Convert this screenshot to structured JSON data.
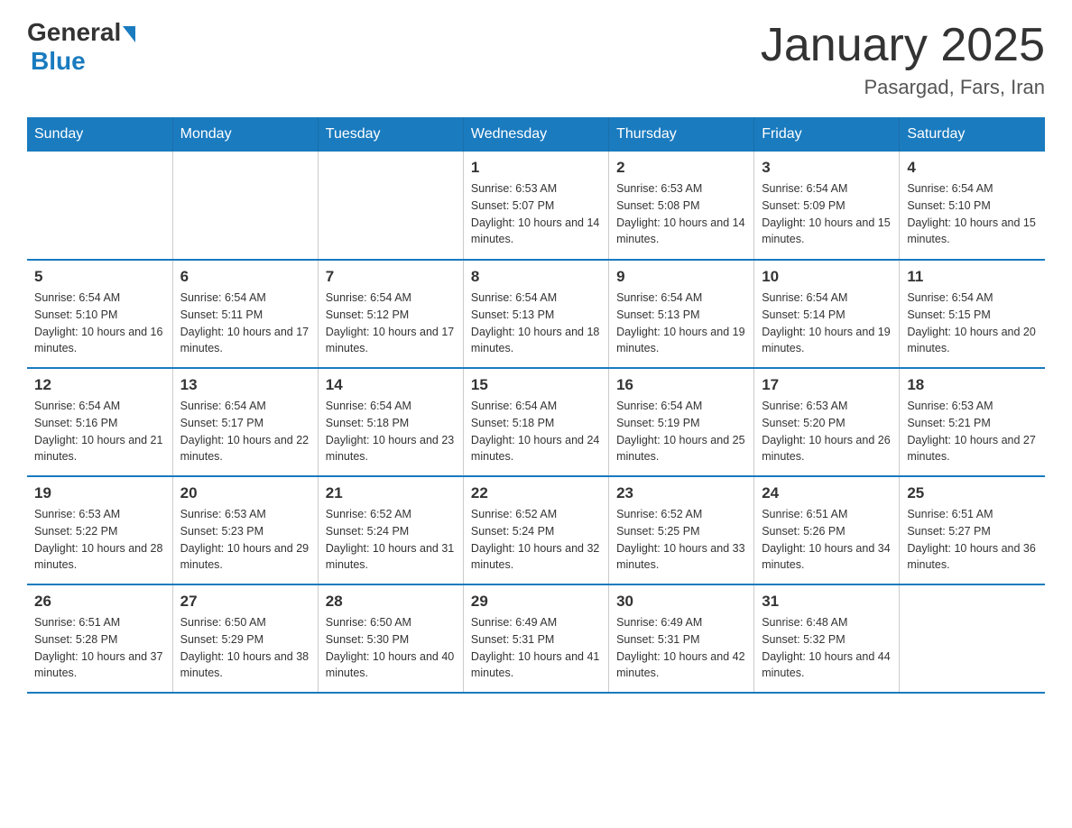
{
  "logo": {
    "general": "General",
    "blue": "Blue"
  },
  "title": "January 2025",
  "subtitle": "Pasargad, Fars, Iran",
  "headers": [
    "Sunday",
    "Monday",
    "Tuesday",
    "Wednesday",
    "Thursday",
    "Friday",
    "Saturday"
  ],
  "weeks": [
    [
      {
        "day": "",
        "sunrise": "",
        "sunset": "",
        "daylight": ""
      },
      {
        "day": "",
        "sunrise": "",
        "sunset": "",
        "daylight": ""
      },
      {
        "day": "",
        "sunrise": "",
        "sunset": "",
        "daylight": ""
      },
      {
        "day": "1",
        "sunrise": "Sunrise: 6:53 AM",
        "sunset": "Sunset: 5:07 PM",
        "daylight": "Daylight: 10 hours and 14 minutes."
      },
      {
        "day": "2",
        "sunrise": "Sunrise: 6:53 AM",
        "sunset": "Sunset: 5:08 PM",
        "daylight": "Daylight: 10 hours and 14 minutes."
      },
      {
        "day": "3",
        "sunrise": "Sunrise: 6:54 AM",
        "sunset": "Sunset: 5:09 PM",
        "daylight": "Daylight: 10 hours and 15 minutes."
      },
      {
        "day": "4",
        "sunrise": "Sunrise: 6:54 AM",
        "sunset": "Sunset: 5:10 PM",
        "daylight": "Daylight: 10 hours and 15 minutes."
      }
    ],
    [
      {
        "day": "5",
        "sunrise": "Sunrise: 6:54 AM",
        "sunset": "Sunset: 5:10 PM",
        "daylight": "Daylight: 10 hours and 16 minutes."
      },
      {
        "day": "6",
        "sunrise": "Sunrise: 6:54 AM",
        "sunset": "Sunset: 5:11 PM",
        "daylight": "Daylight: 10 hours and 17 minutes."
      },
      {
        "day": "7",
        "sunrise": "Sunrise: 6:54 AM",
        "sunset": "Sunset: 5:12 PM",
        "daylight": "Daylight: 10 hours and 17 minutes."
      },
      {
        "day": "8",
        "sunrise": "Sunrise: 6:54 AM",
        "sunset": "Sunset: 5:13 PM",
        "daylight": "Daylight: 10 hours and 18 minutes."
      },
      {
        "day": "9",
        "sunrise": "Sunrise: 6:54 AM",
        "sunset": "Sunset: 5:13 PM",
        "daylight": "Daylight: 10 hours and 19 minutes."
      },
      {
        "day": "10",
        "sunrise": "Sunrise: 6:54 AM",
        "sunset": "Sunset: 5:14 PM",
        "daylight": "Daylight: 10 hours and 19 minutes."
      },
      {
        "day": "11",
        "sunrise": "Sunrise: 6:54 AM",
        "sunset": "Sunset: 5:15 PM",
        "daylight": "Daylight: 10 hours and 20 minutes."
      }
    ],
    [
      {
        "day": "12",
        "sunrise": "Sunrise: 6:54 AM",
        "sunset": "Sunset: 5:16 PM",
        "daylight": "Daylight: 10 hours and 21 minutes."
      },
      {
        "day": "13",
        "sunrise": "Sunrise: 6:54 AM",
        "sunset": "Sunset: 5:17 PM",
        "daylight": "Daylight: 10 hours and 22 minutes."
      },
      {
        "day": "14",
        "sunrise": "Sunrise: 6:54 AM",
        "sunset": "Sunset: 5:18 PM",
        "daylight": "Daylight: 10 hours and 23 minutes."
      },
      {
        "day": "15",
        "sunrise": "Sunrise: 6:54 AM",
        "sunset": "Sunset: 5:18 PM",
        "daylight": "Daylight: 10 hours and 24 minutes."
      },
      {
        "day": "16",
        "sunrise": "Sunrise: 6:54 AM",
        "sunset": "Sunset: 5:19 PM",
        "daylight": "Daylight: 10 hours and 25 minutes."
      },
      {
        "day": "17",
        "sunrise": "Sunrise: 6:53 AM",
        "sunset": "Sunset: 5:20 PM",
        "daylight": "Daylight: 10 hours and 26 minutes."
      },
      {
        "day": "18",
        "sunrise": "Sunrise: 6:53 AM",
        "sunset": "Sunset: 5:21 PM",
        "daylight": "Daylight: 10 hours and 27 minutes."
      }
    ],
    [
      {
        "day": "19",
        "sunrise": "Sunrise: 6:53 AM",
        "sunset": "Sunset: 5:22 PM",
        "daylight": "Daylight: 10 hours and 28 minutes."
      },
      {
        "day": "20",
        "sunrise": "Sunrise: 6:53 AM",
        "sunset": "Sunset: 5:23 PM",
        "daylight": "Daylight: 10 hours and 29 minutes."
      },
      {
        "day": "21",
        "sunrise": "Sunrise: 6:52 AM",
        "sunset": "Sunset: 5:24 PM",
        "daylight": "Daylight: 10 hours and 31 minutes."
      },
      {
        "day": "22",
        "sunrise": "Sunrise: 6:52 AM",
        "sunset": "Sunset: 5:24 PM",
        "daylight": "Daylight: 10 hours and 32 minutes."
      },
      {
        "day": "23",
        "sunrise": "Sunrise: 6:52 AM",
        "sunset": "Sunset: 5:25 PM",
        "daylight": "Daylight: 10 hours and 33 minutes."
      },
      {
        "day": "24",
        "sunrise": "Sunrise: 6:51 AM",
        "sunset": "Sunset: 5:26 PM",
        "daylight": "Daylight: 10 hours and 34 minutes."
      },
      {
        "day": "25",
        "sunrise": "Sunrise: 6:51 AM",
        "sunset": "Sunset: 5:27 PM",
        "daylight": "Daylight: 10 hours and 36 minutes."
      }
    ],
    [
      {
        "day": "26",
        "sunrise": "Sunrise: 6:51 AM",
        "sunset": "Sunset: 5:28 PM",
        "daylight": "Daylight: 10 hours and 37 minutes."
      },
      {
        "day": "27",
        "sunrise": "Sunrise: 6:50 AM",
        "sunset": "Sunset: 5:29 PM",
        "daylight": "Daylight: 10 hours and 38 minutes."
      },
      {
        "day": "28",
        "sunrise": "Sunrise: 6:50 AM",
        "sunset": "Sunset: 5:30 PM",
        "daylight": "Daylight: 10 hours and 40 minutes."
      },
      {
        "day": "29",
        "sunrise": "Sunrise: 6:49 AM",
        "sunset": "Sunset: 5:31 PM",
        "daylight": "Daylight: 10 hours and 41 minutes."
      },
      {
        "day": "30",
        "sunrise": "Sunrise: 6:49 AM",
        "sunset": "Sunset: 5:31 PM",
        "daylight": "Daylight: 10 hours and 42 minutes."
      },
      {
        "day": "31",
        "sunrise": "Sunrise: 6:48 AM",
        "sunset": "Sunset: 5:32 PM",
        "daylight": "Daylight: 10 hours and 44 minutes."
      },
      {
        "day": "",
        "sunrise": "",
        "sunset": "",
        "daylight": ""
      }
    ]
  ]
}
